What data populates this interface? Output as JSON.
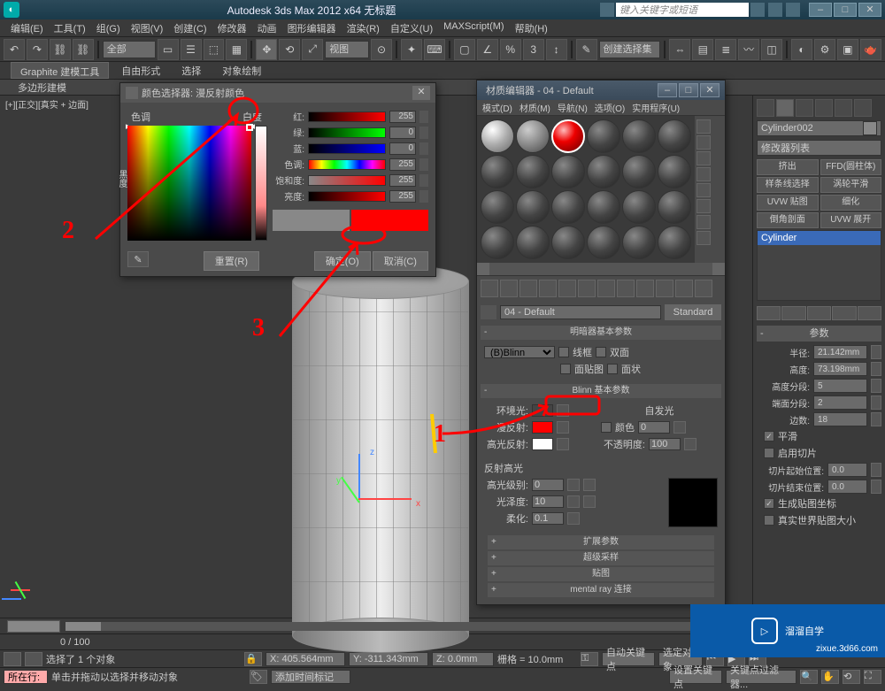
{
  "titlebar": {
    "text": "Autodesk 3ds Max  2012 x64   无标题",
    "search_ph": "键入关键字或短语"
  },
  "menu": [
    "编辑(E)",
    "工具(T)",
    "组(G)",
    "视图(V)",
    "创建(C)",
    "修改器",
    "动画",
    "图形编辑器",
    "渲染(R)",
    "自定义(U)",
    "MAXScript(M)",
    "帮助(H)"
  ],
  "toolbar": {
    "set": "全部",
    "view": "视图",
    "snap": "3",
    "selset": "创建选择集"
  },
  "ribbon": {
    "title": "Graphite 建模工具",
    "tabs": [
      "Graphite 建模工具",
      "自由形式",
      "选择",
      "对象绘制"
    ],
    "sub": "多边形建模"
  },
  "viewport": {
    "label": "[+][正交][真实 + 边面]",
    "axes": [
      "x",
      "y",
      "z"
    ]
  },
  "colorpicker": {
    "title": "颜色选择器: 漫反射颜色",
    "labels": {
      "hue": "色调",
      "white": "白度",
      "black": "黑度"
    },
    "params": [
      {
        "l": "红:",
        "v": "255",
        "grad": "linear-gradient(to right,#000,#f00)"
      },
      {
        "l": "绿:",
        "v": "0",
        "grad": "linear-gradient(to right,#000,#0f0)"
      },
      {
        "l": "蓝:",
        "v": "0",
        "grad": "linear-gradient(to right,#000,#00f)"
      },
      {
        "l": "色调:",
        "v": "255",
        "grad": "linear-gradient(to right,#f00,#ff0,#0f0,#0ff,#00f,#f0f,#f00)"
      },
      {
        "l": "饱和度:",
        "v": "255",
        "grad": "linear-gradient(to right,#888,#f00)"
      },
      {
        "l": "亮度:",
        "v": "255",
        "grad": "linear-gradient(to right,#000,#f00)"
      }
    ],
    "reset": "重置(R)",
    "ok": "确定(O)",
    "cancel": "取消(C)"
  },
  "matedit": {
    "title": "材质编辑器 - 04 - Default",
    "menu": [
      "模式(D)",
      "材质(M)",
      "导航(N)",
      "选项(O)",
      "实用程序(U)"
    ],
    "name": "04 - Default",
    "type": "Standard",
    "headers": {
      "shader": "明暗器基本参数",
      "blinn": "Blinn 基本参数",
      "specular": "反射高光",
      "ext": "扩展参数",
      "ss": "超级采样",
      "maps": "贴图",
      "mr": "mental ray 连接"
    },
    "shader_dd": "(B)Blinn",
    "chk": {
      "wire": "线框",
      "twoside": "双面",
      "facemap": "面贴图",
      "faceted": "面状"
    },
    "rows": {
      "ambient": "环境光:",
      "diffuse": "漫反射:",
      "spec": "高光反射:",
      "selfillum": "自发光",
      "color": "颜色",
      "opacity": "不透明度:",
      "speclvl": "高光级别:",
      "gloss": "光泽度:",
      "soften": "柔化:"
    },
    "vals": {
      "selfillum": "0",
      "opacity": "100",
      "speclvl": "0",
      "gloss": "10",
      "soften": "0.1"
    }
  },
  "cmd": {
    "obj": "Cylinder002",
    "modlist": "修改器列表",
    "mods": [
      [
        "挤出",
        "FFD(圆柱体)"
      ],
      [
        "样条线选择",
        "涡轮平滑"
      ],
      [
        "UVW 贴图",
        "细化"
      ],
      [
        "倒角剖面",
        "UVW 展开"
      ]
    ],
    "item": "Cylinder",
    "head": "参数",
    "params": [
      {
        "l": "半径:",
        "v": "21.142mm"
      },
      {
        "l": "高度:",
        "v": "73.198mm"
      },
      {
        "l": "高度分段:",
        "v": "5"
      },
      {
        "l": "端面分段:",
        "v": "2"
      },
      {
        "l": "边数:",
        "v": "18"
      }
    ],
    "chks": {
      "smooth": "平滑",
      "sliceon": "启用切片",
      "genmap": "生成贴图坐标",
      "realworld": "真实世界贴图大小"
    },
    "slice": [
      {
        "l": "切片起始位置:",
        "v": "0.0"
      },
      {
        "l": "切片结束位置:",
        "v": "0.0"
      }
    ]
  },
  "timeline": {
    "range": "0 / 100"
  },
  "status": {
    "sel": "选择了 1 个对象",
    "hint": "单击并拖动以选择并移动对象",
    "x": "X: 405.564mm",
    "y": "Y: -311.343mm",
    "z": "Z: 0.0mm",
    "grid": "栅格 = 10.0mm",
    "now": "所在行:",
    "addtag": "添加时间标记",
    "autokey": "自动关键点",
    "selkey": "选定对象",
    "setkey": "设置关键点",
    "keyfilter": "关键点过滤器..."
  },
  "annotations": {
    "n1": "1",
    "n2": "2",
    "n3": "3"
  },
  "watermark": {
    "text": "溜溜自学",
    "url": "zixue.3d66.com"
  }
}
